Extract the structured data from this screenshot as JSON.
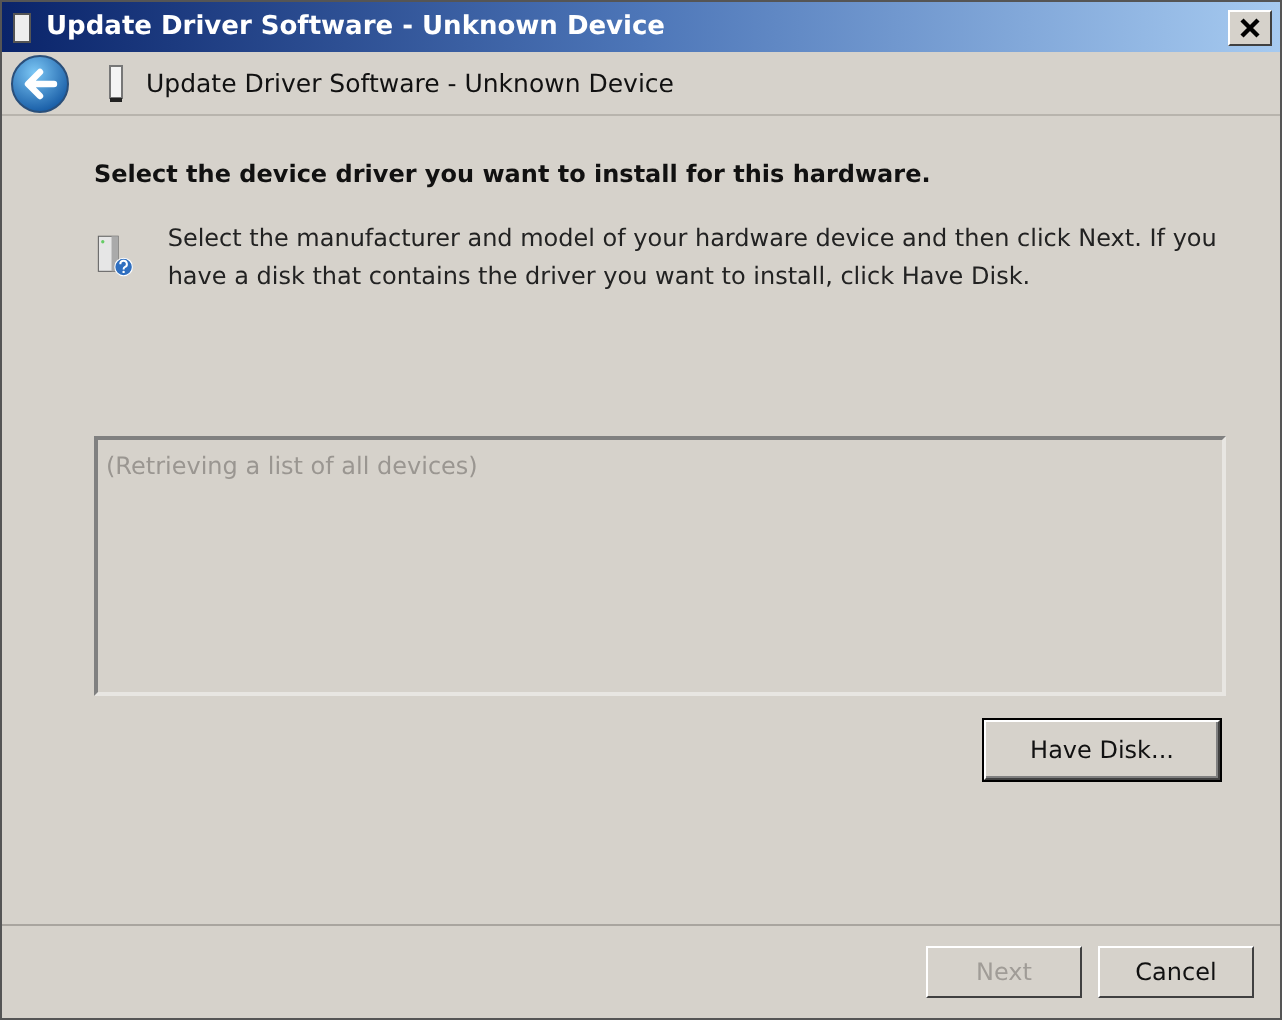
{
  "window": {
    "title": "Update Driver Software - Unknown Device"
  },
  "header": {
    "title": "Update Driver Software - Unknown Device"
  },
  "heading": "Select the device driver you want to install for this hardware.",
  "instructions": "Select the manufacturer and model of your hardware device and then click Next. If you have a disk that contains the driver you want to install, click Have Disk.",
  "device_list": {
    "placeholder": "(Retrieving a list of all devices)"
  },
  "have_disk_button": {
    "label": "Have Disk...",
    "focused": true
  },
  "buttons": [
    {
      "label": "Next",
      "disabled": true
    },
    {
      "label": "Cancel",
      "disabled": false
    }
  ]
}
